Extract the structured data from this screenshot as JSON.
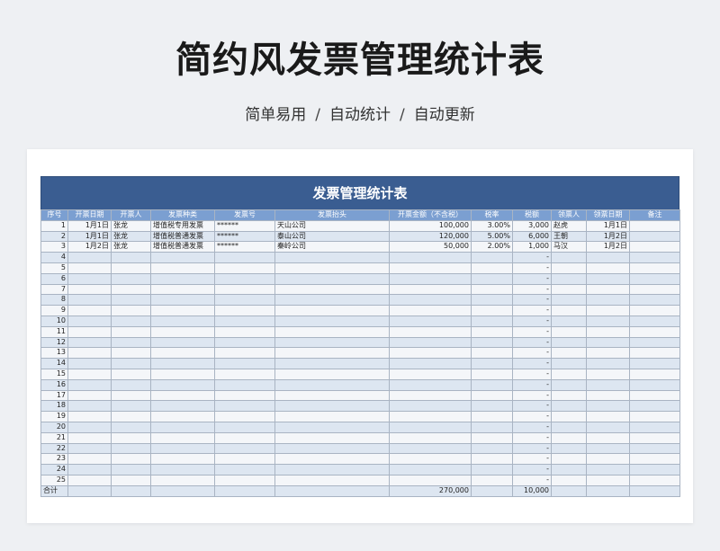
{
  "page": {
    "title": "简约风发票管理统计表",
    "subtitle_parts": [
      "简单易用",
      "自动统计",
      "自动更新"
    ],
    "separator": "/"
  },
  "sheet": {
    "banner_title": "发票管理统计表",
    "headers": [
      "序号",
      "开票日期",
      "开票人",
      "发票种类",
      "发票号",
      "发票抬头",
      "开票金额（不含税）",
      "税率",
      "税额",
      "领票人",
      "领票日期",
      "备注"
    ],
    "rows": [
      [
        "1",
        "1月1日",
        "张龙",
        "增值税专用发票",
        "******",
        "天山公司",
        "100,000",
        "3.00%",
        "3,000",
        "赵虎",
        "1月1日",
        ""
      ],
      [
        "2",
        "1月1日",
        "张龙",
        "增值税普通发票",
        "******",
        "泰山公司",
        "120,000",
        "5.00%",
        "6,000",
        "王朝",
        "1月2日",
        ""
      ],
      [
        "3",
        "1月2日",
        "张龙",
        "增值税普通发票",
        "******",
        "秦岭公司",
        "50,000",
        "2.00%",
        "1,000",
        "马汉",
        "1月2日",
        ""
      ],
      [
        "4",
        "",
        "",
        "",
        "",
        "",
        "",
        "",
        "-",
        "",
        "",
        ""
      ],
      [
        "5",
        "",
        "",
        "",
        "",
        "",
        "",
        "",
        "-",
        "",
        "",
        ""
      ],
      [
        "6",
        "",
        "",
        "",
        "",
        "",
        "",
        "",
        "-",
        "",
        "",
        ""
      ],
      [
        "7",
        "",
        "",
        "",
        "",
        "",
        "",
        "",
        "-",
        "",
        "",
        ""
      ],
      [
        "8",
        "",
        "",
        "",
        "",
        "",
        "",
        "",
        "-",
        "",
        "",
        ""
      ],
      [
        "9",
        "",
        "",
        "",
        "",
        "",
        "",
        "",
        "-",
        "",
        "",
        ""
      ],
      [
        "10",
        "",
        "",
        "",
        "",
        "",
        "",
        "",
        "-",
        "",
        "",
        ""
      ],
      [
        "11",
        "",
        "",
        "",
        "",
        "",
        "",
        "",
        "-",
        "",
        "",
        ""
      ],
      [
        "12",
        "",
        "",
        "",
        "",
        "",
        "",
        "",
        "-",
        "",
        "",
        ""
      ],
      [
        "13",
        "",
        "",
        "",
        "",
        "",
        "",
        "",
        "-",
        "",
        "",
        ""
      ],
      [
        "14",
        "",
        "",
        "",
        "",
        "",
        "",
        "",
        "-",
        "",
        "",
        ""
      ],
      [
        "15",
        "",
        "",
        "",
        "",
        "",
        "",
        "",
        "-",
        "",
        "",
        ""
      ],
      [
        "16",
        "",
        "",
        "",
        "",
        "",
        "",
        "",
        "-",
        "",
        "",
        ""
      ],
      [
        "17",
        "",
        "",
        "",
        "",
        "",
        "",
        "",
        "-",
        "",
        "",
        ""
      ],
      [
        "18",
        "",
        "",
        "",
        "",
        "",
        "",
        "",
        "-",
        "",
        "",
        ""
      ],
      [
        "19",
        "",
        "",
        "",
        "",
        "",
        "",
        "",
        "-",
        "",
        "",
        ""
      ],
      [
        "20",
        "",
        "",
        "",
        "",
        "",
        "",
        "",
        "-",
        "",
        "",
        ""
      ],
      [
        "21",
        "",
        "",
        "",
        "",
        "",
        "",
        "",
        "-",
        "",
        "",
        ""
      ],
      [
        "22",
        "",
        "",
        "",
        "",
        "",
        "",
        "",
        "-",
        "",
        "",
        ""
      ],
      [
        "23",
        "",
        "",
        "",
        "",
        "",
        "",
        "",
        "-",
        "",
        "",
        ""
      ],
      [
        "24",
        "",
        "",
        "",
        "",
        "",
        "",
        "",
        "-",
        "",
        "",
        ""
      ],
      [
        "25",
        "",
        "",
        "",
        "",
        "",
        "",
        "",
        "-",
        "",
        "",
        ""
      ]
    ],
    "total_row": [
      "合计",
      "",
      "",
      "",
      "",
      "",
      "270,000",
      "",
      "10,000",
      "",
      "",
      ""
    ]
  },
  "colors": {
    "banner": "#3a5d91",
    "header": "#7b9fd1",
    "row_light": "#f4f6f9",
    "row_dark": "#dde6f1"
  }
}
